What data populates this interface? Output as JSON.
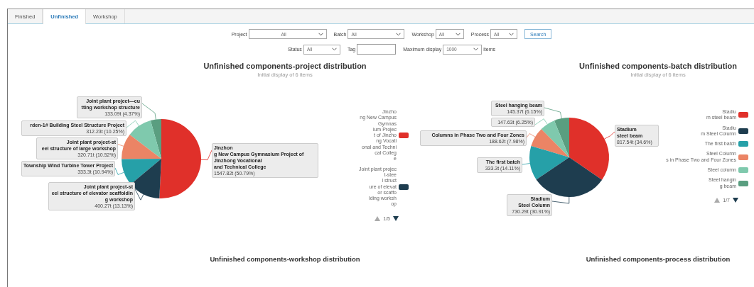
{
  "tabs": [
    {
      "label": "Finished",
      "selected": false
    },
    {
      "label": "Unfinished",
      "selected": true
    },
    {
      "label": "Workshop",
      "selected": false
    }
  ],
  "filters": {
    "rows": [
      [
        {
          "kind": "select",
          "label": "Project",
          "value": "All"
        },
        {
          "kind": "select",
          "label": "Batch",
          "value": "All"
        },
        {
          "kind": "select",
          "label": "Workshop",
          "value": "All"
        },
        {
          "kind": "select",
          "label": "Process",
          "value": "All"
        },
        {
          "kind": "button",
          "label": "Search"
        }
      ],
      [
        {
          "kind": "select",
          "label": "Status",
          "value": "All"
        },
        {
          "kind": "input",
          "label": "Tag"
        },
        {
          "kind": "select",
          "label": "Maximum display",
          "value": "1000",
          "suffix": "items"
        }
      ]
    ]
  },
  "charts": [
    {
      "title": "Unfinished components-project distribution",
      "subtitle": "Initial display of 6 items",
      "chart_data": {
        "type": "pie",
        "values": [
          4.37,
          10.25,
          10.52,
          10.94,
          50.79,
          13.13
        ]
      },
      "slices": [
        {
          "name": "Joint plant project—cu\ntting workshop structure",
          "value_label": "133.09t (4.37%)",
          "color": "#5a9e80"
        },
        {
          "name": "rden-1# Building Steel Structure Project",
          "value_label": "312.23t (10.25%)",
          "color": "#7fc9ad"
        },
        {
          "name": "Joint plant project-st\neel structure of large workshop",
          "value_label": "320.71t (10.52%)",
          "color": "#eb8465"
        },
        {
          "name": "Township Wind Turbine Tower Project",
          "value_label": "333.3t (10.94%)",
          "color": "#26a0a8"
        },
        {
          "name": "Jinzhon\ng New Campus Gymnasium Project of Jinzhong Vocational\n and Technical College",
          "value_label": "1547.82t (50.79%)",
          "color": "#e0302a"
        },
        {
          "name": "Joint plant project-st\neel structure of elevator scaffoldin\ng workshop",
          "value_label": "400.27t (13.13%)",
          "color": "#1e3d4f"
        }
      ],
      "legend": {
        "items": [
          {
            "label": "Jinzho\nng New Campus\nGymnas\nium Projec\nt of Jinzho\nng Vocati\nonal and Techni\ncal Colleg\ne",
            "color": "#e0302a"
          },
          {
            "label": "Joint plant projec\nt-stee\nl struct\nure of elevat\nor scaffo\nlding worksh\nop",
            "color": "#1e3d4f"
          }
        ],
        "page": "1/5"
      }
    },
    {
      "title": "Unfinished components-batch distribution",
      "subtitle": "Initial display of 6 items",
      "chart_data": {
        "type": "pie",
        "values": [
          6.15,
          6.25,
          7.98,
          34.6,
          14.11,
          30.91
        ]
      },
      "slices": [
        {
          "name": "Steel hanging beam",
          "value_label": "145.37t (6.15%)",
          "color": "#5a9e80"
        },
        {
          "value_label": "147.63t (6.25%)",
          "color": "#7fc9ad"
        },
        {
          "name": "Columns in Phase Two and Four Zones",
          "value_label": "188.62t (7.98%)",
          "color": "#eb8465"
        },
        {
          "name": "Stadium\n steel beam",
          "value_label": "817.54t (34.6%)",
          "color": "#e0302a"
        },
        {
          "name": "The first batch",
          "value_label": "333.3t (14.11%)",
          "color": "#26a0a8"
        },
        {
          "name": "Stadium\n Steel Column",
          "value_label": "730.29t (30.91%)",
          "color": "#1e3d4f"
        }
      ],
      "legend": {
        "items": [
          {
            "label": "Stadiu\nm steel beam",
            "color": "#e0302a"
          },
          {
            "label": "Stadiu\nm Steel Column",
            "color": "#1e3d4f"
          },
          {
            "label": "The first batch",
            "color": "#26a0a8"
          },
          {
            "label": "Steel Column\ns in Phase Two and Four Zones",
            "color": "#eb8465"
          },
          {
            "label": "Steel column",
            "color": "#7fc9ad"
          },
          {
            "label": "Steel hangin\ng beam",
            "color": "#5a9e80"
          }
        ],
        "page": "1/7"
      }
    }
  ],
  "bottom_titles": [
    "Unfinished components-workshop distribution",
    "Unfinished components-process distribution"
  ]
}
